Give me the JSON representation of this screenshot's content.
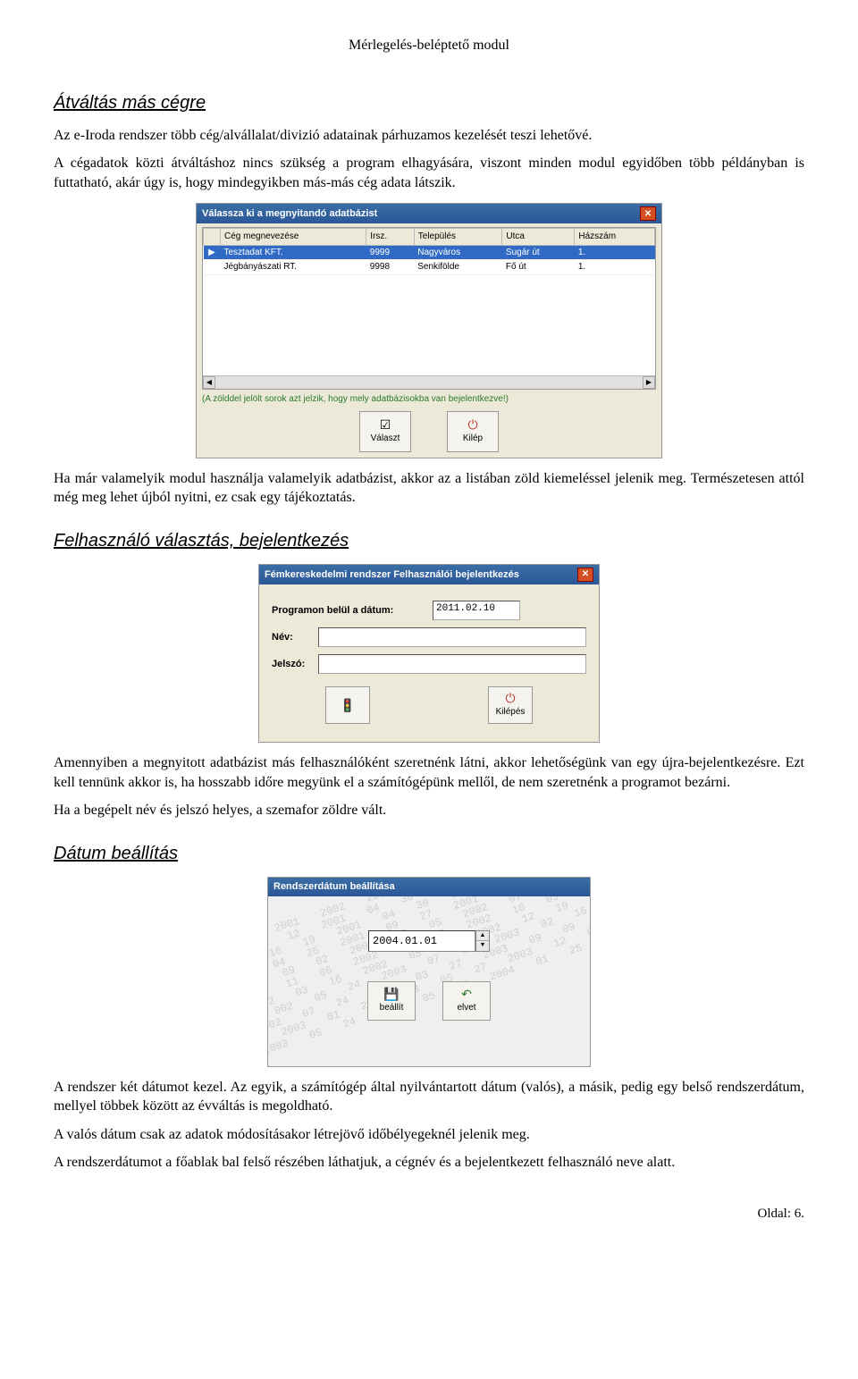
{
  "header": {
    "title": "Mérlegelés-beléptető modul"
  },
  "sections": {
    "s1": {
      "heading": "Átváltás más cégre",
      "p1": "Az e-Iroda rendszer több cég/alvállalat/divizió adatainak párhuzamos kezelését teszi lehetővé.",
      "p2": "A cégadatok közti átváltáshoz nincs szükség a program elhagyására, viszont minden modul egyidőben több példányban is futtatható, akár úgy is, hogy mindegyikben más-más cég adata látszik.",
      "p3": "Ha már valamelyik modul használja valamelyik adatbázist, akkor az a listában zöld kiemeléssel jelenik meg. Természetesen attól még meg lehet újból nyitni, ez csak egy tájékoztatás."
    },
    "s2": {
      "heading": "Felhasználó választás, bejelentkezés",
      "p1": "Amennyiben a megnyitott adatbázist más felhasználóként szeretnénk látni, akkor lehetőségünk van egy újra-bejelentkezésre. Ezt kell tennünk akkor is, ha hosszabb időre megyünk el a számítógépünk mellől, de nem szeretnénk a programot bezárni.",
      "p2": "Ha a begépelt név és jelszó helyes, a szemafor zöldre vált."
    },
    "s3": {
      "heading": "Dátum beállítás",
      "p1": "A rendszer két dátumot kezel. Az egyik, a számítógép által nyilvántartott dátum (valós), a másik, pedig egy belső rendszerdátum, mellyel többek között az évváltás is megoldható.",
      "p2": "A valós dátum csak az adatok módosításakor létrejövő időbélyegeknél jelenik meg.",
      "p3": "A rendszerdátumot a főablak bal felső részében láthatjuk, a cégnév és a bejelentkezett felhasználó neve alatt."
    }
  },
  "shot1": {
    "title": "Válassza ki a megnyitandó adatbázist",
    "cols": [
      "Cég megnevezése",
      "Irsz.",
      "Település",
      "Utca",
      "Házszám"
    ],
    "rows": [
      {
        "name": "Tesztadat KFT.",
        "zip": "9999",
        "city": "Nagyváros",
        "street": "Sugár út",
        "num": "1."
      },
      {
        "name": "Jégbányászati RT.",
        "zip": "9998",
        "city": "Senkifölde",
        "street": "Fő út",
        "num": "1."
      }
    ],
    "hint": "(A zölddel jelölt sorok azt jelzik, hogy mely adatbázisokba van bejelentkezve!)",
    "btn_select": "Választ",
    "btn_exit": "Kilép"
  },
  "shot2": {
    "title": "Fémkereskedelmi rendszer Felhasználói bejelentkezés",
    "label_date": "Programon belül a dátum:",
    "date_value": "2011.02.10",
    "label_name": "Név:",
    "name_value": "",
    "label_pass": "Jelszó:",
    "pass_value": "",
    "btn_exit": "Kilépés"
  },
  "shot3": {
    "title": "Rendszerdátum beállítása",
    "date_value": "2004.01.01",
    "btn_set": "beállít",
    "btn_discard": "elvet",
    "bg_pattern": "2000 2001 2002 2003 2004 2005\n 08 12 2001 04 30 01 12 2001 02 05 2002 08 16\n10 16 19 2001 04 30 01 12 2001 03 03 01 05 200\n01 04 25 2001 09 27 2001 07 28 2003 05 05 200\n001 09 02 2002 03 05 2002 07 21 2003 09 12\n001 11 06 2002 05 05 2002 10 03 2003 07 19 200\n2002 03 16 2002 05 25 2002 12 19 2003 11 16\n 002 05 24 2003 07 24 2003 02 16 2004 01 29\n2002 07 24 2003 03 27 2003 09 09 2004 05 02\n 2003 01 22 2003 05 27 2003 12 09 2004 10 06\n2003 05 24 2004 05 17 2004 01 25 2004 10 06\n"
  },
  "footer": {
    "page": "Oldal: 6."
  }
}
